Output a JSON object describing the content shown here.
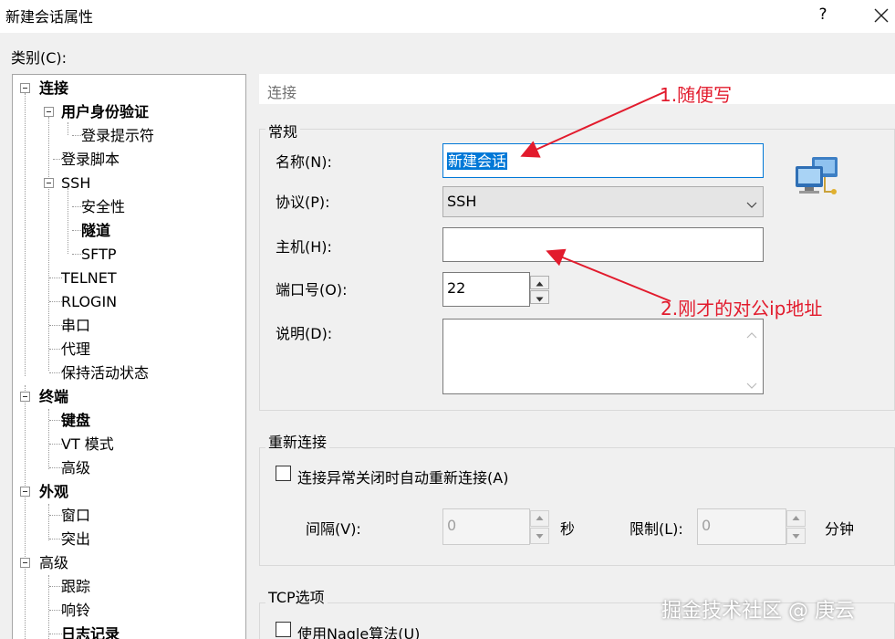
{
  "window": {
    "title": "新建会话属性",
    "help_label": "?",
    "close_icon": "close-icon"
  },
  "category_label": "类别(C):",
  "tree": [
    {
      "label": "连接",
      "bold": true,
      "expanded": true
    },
    {
      "label": "用户身份验证",
      "bold": true,
      "expanded": true
    },
    {
      "label": "登录提示符",
      "bold": false
    },
    {
      "label": "登录脚本",
      "bold": false
    },
    {
      "label": "SSH",
      "bold": false,
      "expanded": true
    },
    {
      "label": "安全性",
      "bold": false
    },
    {
      "label": "隧道",
      "bold": true
    },
    {
      "label": "SFTP",
      "bold": false
    },
    {
      "label": "TELNET",
      "bold": false
    },
    {
      "label": "RLOGIN",
      "bold": false
    },
    {
      "label": "串口",
      "bold": false
    },
    {
      "label": "代理",
      "bold": false
    },
    {
      "label": "保持活动状态",
      "bold": false
    },
    {
      "label": "终端",
      "bold": true,
      "expanded": true
    },
    {
      "label": "键盘",
      "bold": true
    },
    {
      "label": "VT 模式",
      "bold": false
    },
    {
      "label": "高级",
      "bold": false
    },
    {
      "label": "外观",
      "bold": true,
      "expanded": true
    },
    {
      "label": "窗口",
      "bold": false
    },
    {
      "label": "突出",
      "bold": false
    },
    {
      "label": "高级",
      "bold": false,
      "expanded": true
    },
    {
      "label": "跟踪",
      "bold": false
    },
    {
      "label": "响铃",
      "bold": false
    },
    {
      "label": "日志记录",
      "bold": true
    }
  ],
  "section_title": "连接",
  "general": {
    "title": "常规",
    "name_label": "名称(N):",
    "name_value": "新建会话",
    "protocol_label": "协议(P):",
    "protocol_value": "SSH",
    "host_label": "主机(H):",
    "host_value": "",
    "port_label": "端口号(O):",
    "port_value": "22",
    "desc_label": "说明(D):",
    "desc_value": "",
    "icon": "network-computers-icon"
  },
  "reconnect": {
    "title": "重新连接",
    "checkbox_label": "连接异常关闭时自动重新连接(A)",
    "checked": false,
    "interval_label": "间隔(V):",
    "interval_value": "0",
    "interval_unit": "秒",
    "limit_label": "限制(L):",
    "limit_value": "0",
    "limit_unit": "分钟"
  },
  "tcp": {
    "title": "TCP选项",
    "nagle_label": "使用Nagle算法(U)",
    "checked": false
  },
  "annotations": {
    "note1": "1.随便写",
    "note2": "2.刚才的对公ip地址",
    "color": "#e21b2d"
  },
  "watermark": "掘金技术社区 @ 庚云",
  "colors": {
    "accent": "#0078d7",
    "annotation": "#e21b2d"
  }
}
